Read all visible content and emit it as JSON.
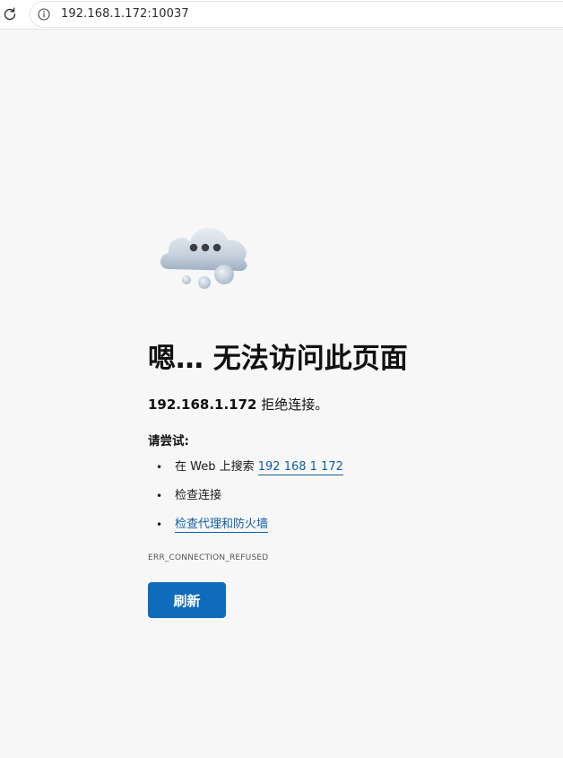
{
  "browser": {
    "url": "192.168.1.172:10037",
    "reload_icon": "reload-icon",
    "info_icon": "info-circle-icon"
  },
  "error": {
    "illustration": "cloud-ellipsis-icon",
    "title": "嗯… 无法访问此页面",
    "host": "192.168.1.172",
    "message": " 拒绝连接。",
    "try_label": "请尝试:",
    "suggestions": [
      {
        "prefix": "在 Web 上搜索 ",
        "link": "192 168 1 172"
      },
      {
        "prefix": "检查连接",
        "link": ""
      },
      {
        "prefix": "",
        "link": "检查代理和防火墙"
      }
    ],
    "bullet": "•",
    "code": "ERR_CONNECTION_REFUSED",
    "refresh_label": "刷新"
  },
  "colors": {
    "background": "#f7f7f7",
    "link": "#115ea3",
    "button": "#0f6cbd"
  }
}
